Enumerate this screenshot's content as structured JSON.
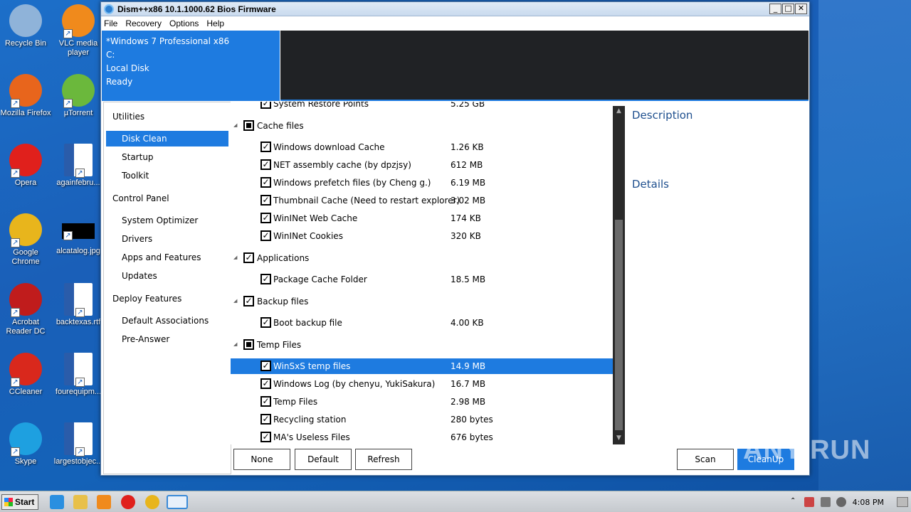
{
  "desktop": {
    "icons": [
      {
        "label": "Recycle Bin",
        "icon": "recycle-bin-icon",
        "color": "#8fb3d9"
      },
      {
        "label": "VLC media player",
        "icon": "vlc-icon",
        "color": "#f08a1c"
      },
      {
        "label": "Mozilla Firefox",
        "icon": "firefox-icon",
        "color": "#e8651c"
      },
      {
        "label": "µTorrent",
        "icon": "utorrent-icon",
        "color": "#6bb83c"
      },
      {
        "label": "Opera",
        "icon": "opera-icon",
        "color": "#e0201c"
      },
      {
        "label": "againfebru...",
        "icon": "word-doc-icon",
        "color": "#2a5caa"
      },
      {
        "label": "Google Chrome",
        "icon": "chrome-icon",
        "color": "#e8b51c"
      },
      {
        "label": "alcatalog.jpg",
        "icon": "image-file-icon",
        "color": "#000000"
      },
      {
        "label": "Acrobat Reader DC",
        "icon": "acrobat-icon",
        "color": "#c01c1c"
      },
      {
        "label": "backtexas.rtf",
        "icon": "word-doc-icon",
        "color": "#2a5caa"
      },
      {
        "label": "CCleaner",
        "icon": "ccleaner-icon",
        "color": "#d9281c"
      },
      {
        "label": "fourequipm...",
        "icon": "word-doc-icon",
        "color": "#2a5caa"
      },
      {
        "label": "Skype",
        "icon": "skype-icon",
        "color": "#1ea0e0"
      },
      {
        "label": "largestobjec...",
        "icon": "word-doc-icon",
        "color": "#2a5caa"
      }
    ]
  },
  "window": {
    "title": "Dism++x86 10.1.1000.62 Bios Firmware",
    "menu": [
      "File",
      "Recovery",
      "Options",
      "Help"
    ],
    "info": [
      "*Windows 7 Professional x86",
      "C:",
      "Local Disk",
      "Ready"
    ],
    "accent": "#1e7be0"
  },
  "nav": {
    "items": [
      {
        "label": "Utilities",
        "level": 0,
        "selected": false
      },
      {
        "label": "Disk Clean",
        "level": 1,
        "selected": true
      },
      {
        "label": "Startup",
        "level": 1,
        "selected": false
      },
      {
        "label": "Toolkit",
        "level": 1,
        "selected": false
      },
      {
        "label": "Control Panel",
        "level": 0,
        "selected": false
      },
      {
        "label": "System Optimizer",
        "level": 1,
        "selected": false
      },
      {
        "label": "Drivers",
        "level": 1,
        "selected": false
      },
      {
        "label": "Apps and Features",
        "level": 1,
        "selected": false
      },
      {
        "label": "Updates",
        "level": 1,
        "selected": false
      },
      {
        "label": "Deploy Features",
        "level": 0,
        "selected": false
      },
      {
        "label": "Default Associations",
        "level": 1,
        "selected": false
      },
      {
        "label": "Pre-Answer",
        "level": 1,
        "selected": false
      }
    ]
  },
  "clean_list": {
    "rows": [
      {
        "type": "item",
        "label": "System Restore Points",
        "size": "5.25 GB",
        "checked": true,
        "selected": false
      },
      {
        "type": "group",
        "label": "Cache files",
        "state": "indeterminate"
      },
      {
        "type": "item",
        "label": "Windows download Cache",
        "size": "1.26 KB",
        "checked": true,
        "selected": false
      },
      {
        "type": "item",
        "label": "NET assembly cache (by dpzjsy)",
        "size": "612 MB",
        "checked": true,
        "selected": false
      },
      {
        "type": "item",
        "label": "Windows prefetch files (by Cheng g.)",
        "size": "6.19 MB",
        "checked": true,
        "selected": false
      },
      {
        "type": "item",
        "label": "Thumbnail Cache (Need to restart explorer)",
        "size": "3.02 MB",
        "checked": true,
        "selected": false
      },
      {
        "type": "item",
        "label": "WinINet Web Cache",
        "size": "174 KB",
        "checked": true,
        "selected": false
      },
      {
        "type": "item",
        "label": "WinINet Cookies",
        "size": "320 KB",
        "checked": true,
        "selected": false
      },
      {
        "type": "group",
        "label": "Applications",
        "state": "checked"
      },
      {
        "type": "item",
        "label": "Package Cache Folder",
        "size": "18.5 MB",
        "checked": true,
        "selected": false
      },
      {
        "type": "group",
        "label": "Backup files",
        "state": "checked"
      },
      {
        "type": "item",
        "label": "Boot backup file",
        "size": "4.00 KB",
        "checked": true,
        "selected": false
      },
      {
        "type": "group",
        "label": "Temp Files",
        "state": "indeterminate"
      },
      {
        "type": "item",
        "label": "WinSxS temp files",
        "size": "14.9 MB",
        "checked": true,
        "selected": true
      },
      {
        "type": "item",
        "label": "Windows Log (by chenyu, YukiSakura)",
        "size": "16.7 MB",
        "checked": true,
        "selected": false
      },
      {
        "type": "item",
        "label": "Temp Files",
        "size": "2.98 MB",
        "checked": true,
        "selected": false
      },
      {
        "type": "item",
        "label": "Recycling station",
        "size": "280 bytes",
        "checked": true,
        "selected": false
      },
      {
        "type": "item",
        "label": "MA's Useless Files",
        "size": "676 bytes",
        "checked": true,
        "selected": false
      }
    ]
  },
  "side": {
    "description": "Description",
    "details": "Details"
  },
  "buttons": {
    "none": "None",
    "default": "Default",
    "refresh": "Refresh",
    "scan": "Scan",
    "cleanup": "CleanUp"
  },
  "watermark": "ANY RUN",
  "taskbar": {
    "start": "Start",
    "apps": [
      {
        "icon": "ie-icon",
        "color": "#2a8fe0"
      },
      {
        "icon": "explorer-icon",
        "color": "#e8c04a"
      },
      {
        "icon": "media-player-icon",
        "color": "#f08a1c"
      },
      {
        "icon": "opera-icon",
        "color": "#e0201c"
      },
      {
        "icon": "chrome-icon",
        "color": "#e8b51c"
      },
      {
        "icon": "dism-icon",
        "color": "#2d7fd0"
      }
    ],
    "clock": "4:08 PM"
  }
}
